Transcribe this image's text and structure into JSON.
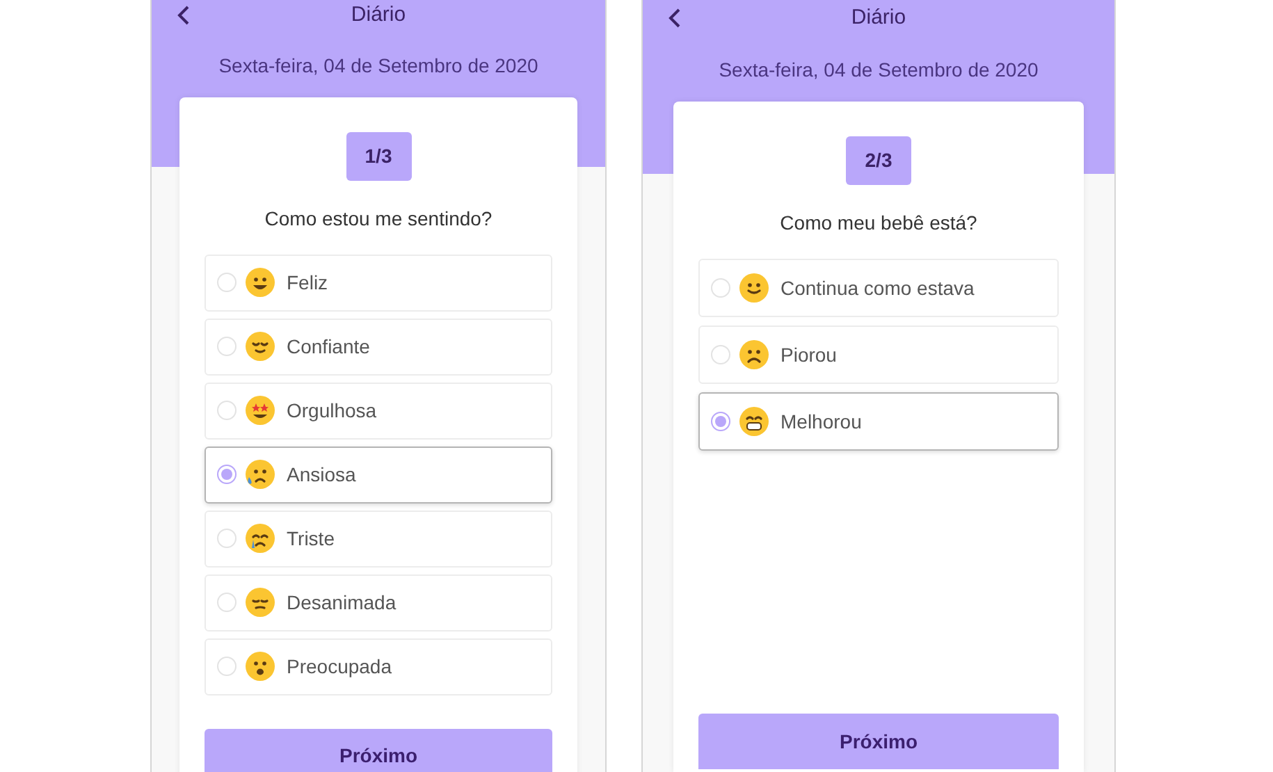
{
  "screens": [
    {
      "title": "Diário",
      "date": "Sexta-feira, 04 de Setembro de 2020",
      "step": "1/3",
      "question": "Como estou me sentindo?",
      "options": [
        {
          "label": "Feliz",
          "kind": "grinning",
          "selected": false
        },
        {
          "label": "Confiante",
          "kind": "relieved",
          "selected": false
        },
        {
          "label": "Orgulhosa",
          "kind": "star-struck",
          "selected": false
        },
        {
          "label": "Ansiosa",
          "kind": "anxious",
          "selected": true
        },
        {
          "label": "Triste",
          "kind": "crying",
          "selected": false
        },
        {
          "label": "Desanimada",
          "kind": "pensive",
          "selected": false
        },
        {
          "label": "Preocupada",
          "kind": "worried",
          "selected": false
        }
      ],
      "next": "Próximo"
    },
    {
      "title": "Diário",
      "date": "Sexta-feira, 04 de Setembro de 2020",
      "step": "2/3",
      "question": "Como meu bebê está?",
      "options": [
        {
          "label": "Continua como estava",
          "kind": "slight-smile",
          "selected": false
        },
        {
          "label": "Piorou",
          "kind": "frowning",
          "selected": false
        },
        {
          "label": "Melhorou",
          "kind": "grimacing",
          "selected": true
        }
      ],
      "next": "Próximo"
    }
  ]
}
